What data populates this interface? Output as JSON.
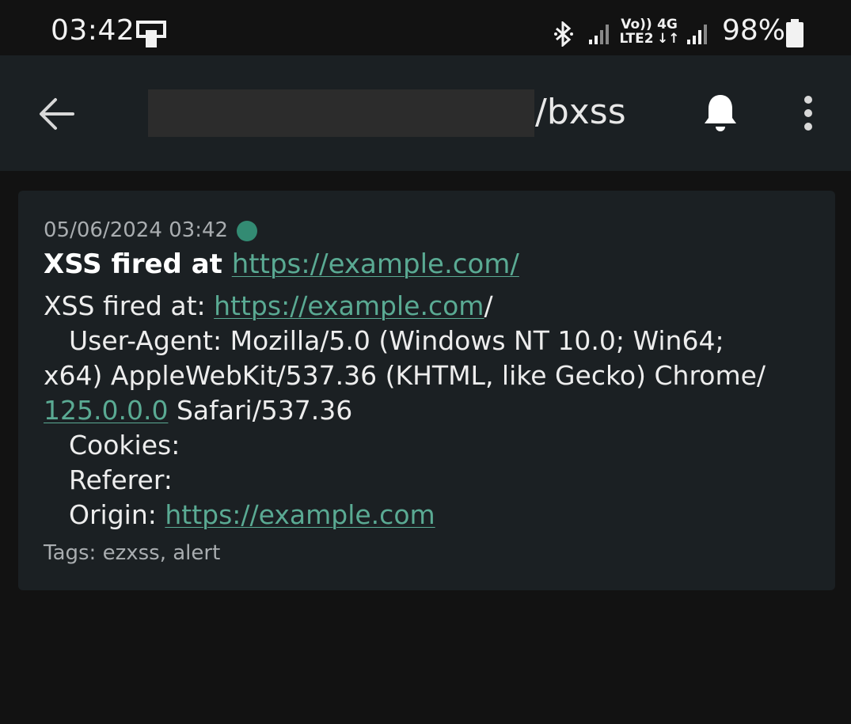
{
  "status_bar": {
    "time": "03:42",
    "network_labels": {
      "volte": "Vo))",
      "lte": "LTE2",
      "type": "4G"
    },
    "battery": "98%",
    "icons": [
      "sim-toolkit-icon",
      "bluetooth-icon",
      "signal-icon",
      "signal-icon",
      "battery-icon"
    ]
  },
  "app_bar": {
    "topic_suffix": "/bxss",
    "icons": [
      "back-arrow-icon",
      "bell-icon",
      "more-vert-icon"
    ]
  },
  "notification": {
    "date": "05/06/2024 03:42",
    "title_prefix": "XSS fired at ",
    "title_link": "https://example.com/",
    "body": {
      "line1_prefix": "XSS fired at: ",
      "line1_link": "https://example.com",
      "line1_suffix": "/",
      "user_agent_line": "User-Agent: Mozilla/5.0 (Windows NT 10.0; Win64;",
      "user_agent_cont": "x64) AppleWebKit/537.36 (KHTML, like Gecko) Chrome/",
      "chrome_version_link": "125.0.0.0",
      "safari_suffix": " Safari/537.36",
      "cookies": "Cookies:",
      "referer": "Referer:",
      "origin_label": "Origin: ",
      "origin_link": "https://example.com"
    },
    "tags": "Tags: ezxss, alert"
  },
  "colors": {
    "background": "#121212",
    "app_bar": "#1b2023",
    "card": "#1b2023",
    "accent": "#338b73",
    "link": "#5aaa93"
  }
}
